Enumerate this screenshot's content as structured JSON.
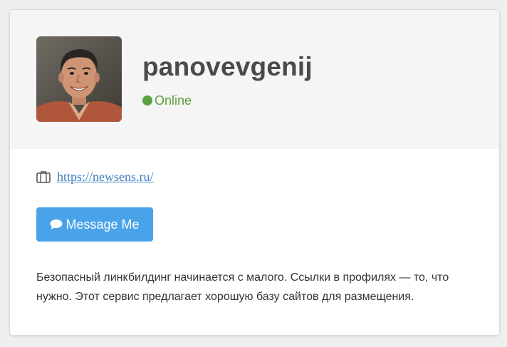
{
  "profile": {
    "username": "panovevgenij",
    "status": "Online",
    "status_color": "#5aa03c",
    "avatar_icon": "user-photo"
  },
  "website": {
    "icon": "briefcase-icon",
    "url": "https://newsens.ru/"
  },
  "actions": {
    "message_icon": "chat-bubble-icon",
    "message_label": "Message Me",
    "button_color": "#4aa3e8"
  },
  "bio": {
    "text": "Безопасный линкбилдинг начинается с малого. Ссылки в профилях — то, что нужно. Этот сервис предлагает хорошую базу сайтов для размещения."
  }
}
